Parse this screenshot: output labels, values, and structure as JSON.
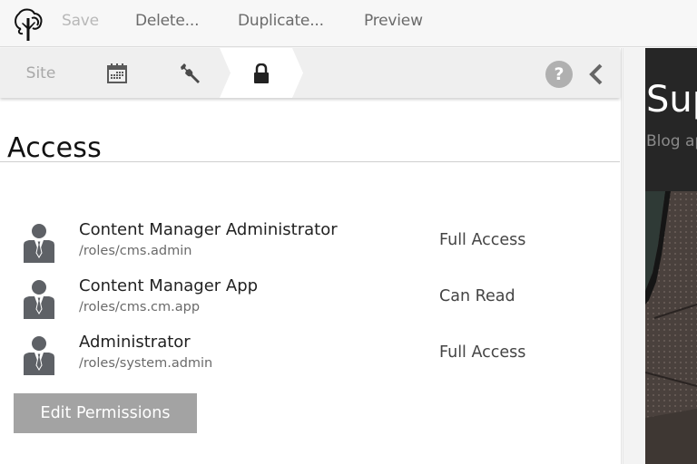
{
  "toolbar": {
    "logo": "tree-logo",
    "save_label": "Save",
    "delete_label": "Delete...",
    "duplicate_label": "Duplicate...",
    "preview_label": "Preview"
  },
  "tabs": {
    "site_label": "Site",
    "calendar_icon": "calendar-icon",
    "tools_icon": "wrench-icon",
    "access_icon": "lock-icon",
    "help_label": "?",
    "collapse_icon": "chevron-left-icon"
  },
  "main": {
    "title": "Access",
    "roles": [
      {
        "name": "Content Manager Administrator",
        "path": "/roles/cms.admin",
        "permission": "Full Access"
      },
      {
        "name": "Content Manager App",
        "path": "/roles/cms.cm.app",
        "permission": "Can Read"
      },
      {
        "name": "Administrator",
        "path": "/roles/system.admin",
        "permission": "Full Access"
      }
    ],
    "edit_button_label": "Edit Permissions"
  },
  "preview": {
    "title": "Sup",
    "subtitle": "Blog ap"
  },
  "colors": {
    "toolbar_bg": "#f7f7f7",
    "tabbar_bg": "#efefef",
    "icon_gray": "#555555",
    "button_gray": "#a3a3a3",
    "preview_bg": "#262626"
  }
}
